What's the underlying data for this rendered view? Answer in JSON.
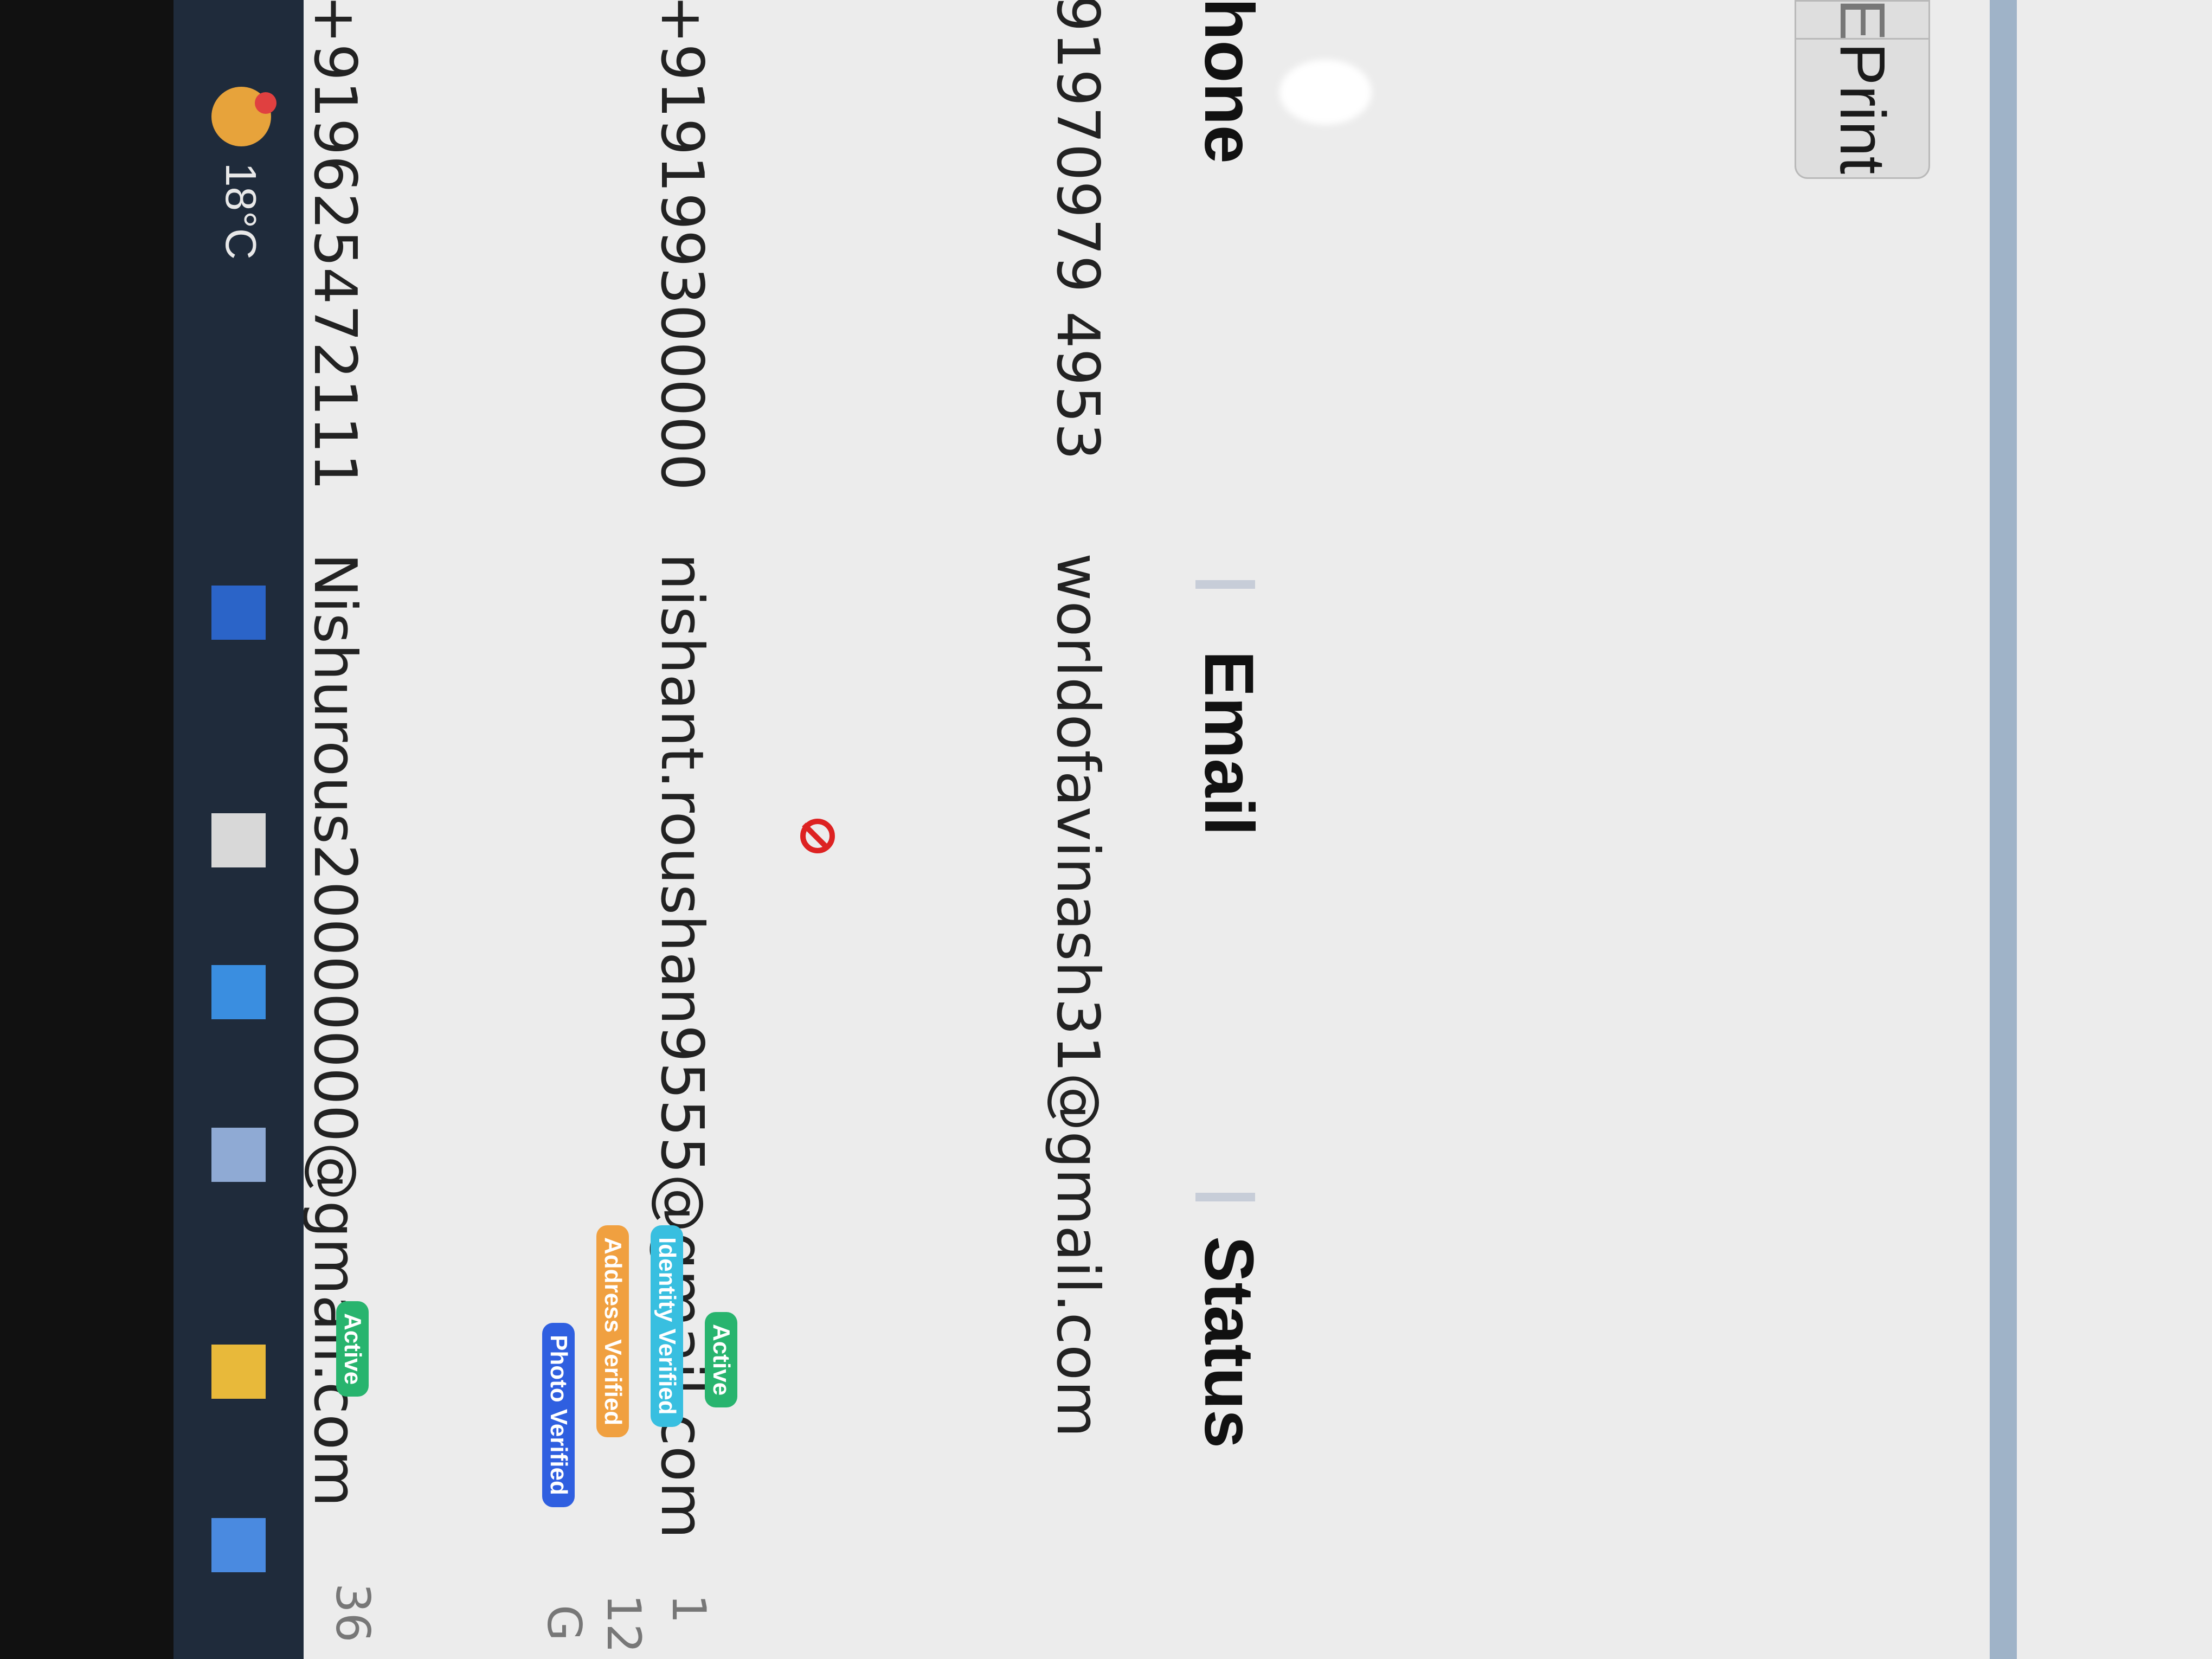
{
  "toolbar": {
    "prev_button_partial": "E",
    "print_button": "Print"
  },
  "table": {
    "headers": {
      "phone": "hone",
      "email": "Email",
      "status": "Status"
    },
    "rows": [
      {
        "phone": "91970979 4953",
        "email": "worldofavinash31@gmail.com",
        "badges": []
      },
      {
        "phone": "+919199300000",
        "email": "nishant.roushan9555@gmail.com",
        "badges": [
          "Active",
          "Identity Verified",
          "Address Verified",
          "Photo Verified"
        ]
      },
      {
        "phone": "+919625472111",
        "email": "Nishurous20000000@gmail.com",
        "badges": [
          "Active"
        ]
      }
    ],
    "right_edge_cells": [
      "1",
      "12",
      "G",
      "36"
    ]
  },
  "taskbar": {
    "temperature": "18°C",
    "notification_count": "1"
  },
  "colors": {
    "active": "#28b46e",
    "identity": "#38bfe0",
    "address": "#f0a040",
    "photo": "#2f5fe0",
    "block": "#dd2222"
  },
  "icons": [
    "blocked-icon",
    "weather-icon",
    "file-explorer-icon",
    "vscode-icon",
    "notepad-icon",
    "word-icon"
  ]
}
